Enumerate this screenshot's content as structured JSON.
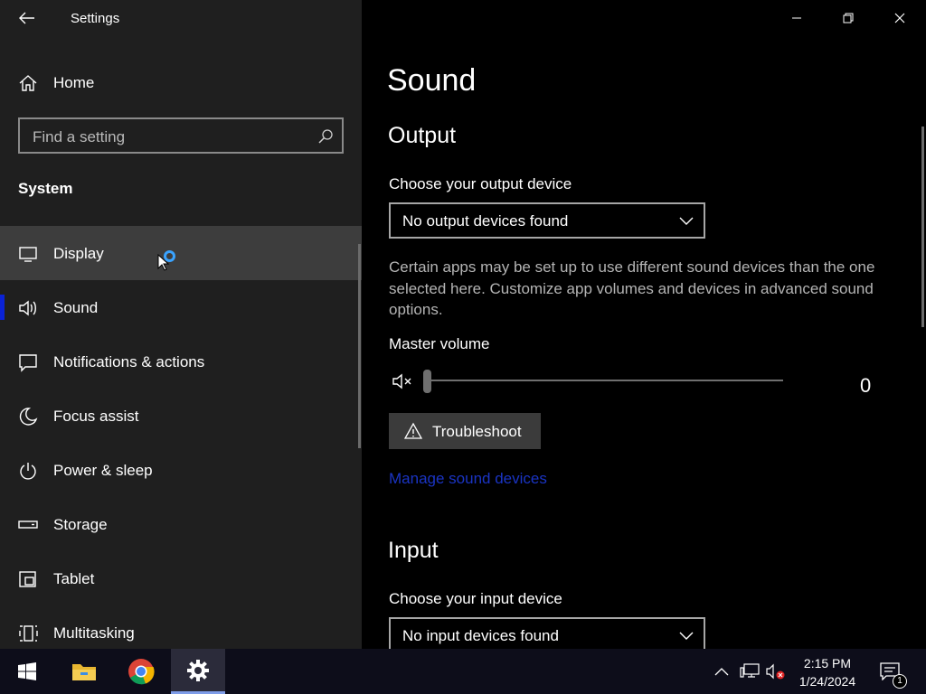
{
  "window": {
    "title": "Settings",
    "controls": {
      "minimize": "minimize-icon",
      "maximize": "restore-icon",
      "close": "close-icon"
    }
  },
  "sidebar": {
    "home_label": "Home",
    "search": {
      "placeholder": "Find a setting",
      "icon": "search-icon"
    },
    "section_label": "System",
    "items": [
      {
        "label": "Display",
        "icon": "monitor-icon",
        "state": "hover"
      },
      {
        "label": "Sound",
        "icon": "speaker-icon",
        "state": "selected"
      },
      {
        "label": "Notifications & actions",
        "icon": "message-icon",
        "state": ""
      },
      {
        "label": "Focus assist",
        "icon": "moon-icon",
        "state": ""
      },
      {
        "label": "Power & sleep",
        "icon": "power-icon",
        "state": ""
      },
      {
        "label": "Storage",
        "icon": "storage-icon",
        "state": ""
      },
      {
        "label": "Tablet",
        "icon": "tablet-icon",
        "state": ""
      },
      {
        "label": "Multitasking",
        "icon": "multitasking-icon",
        "state": ""
      }
    ]
  },
  "main": {
    "page_title": "Sound",
    "output": {
      "heading": "Output",
      "choose_label": "Choose your output device",
      "device_value": "No output devices found",
      "description": "Certain apps may be set up to use different sound devices than the one selected here. Customize app volumes and devices in advanced sound options.",
      "master_volume_label": "Master volume",
      "master_volume_value": "0",
      "master_volume_level": 0,
      "troubleshoot_label": "Troubleshoot",
      "manage_link": "Manage sound devices"
    },
    "input": {
      "heading": "Input",
      "choose_label": "Choose your input device",
      "device_value": "No input devices found"
    }
  },
  "taskbar": {
    "apps": [
      "start-icon",
      "file-explorer-icon",
      "chrome-icon",
      "settings-icon"
    ],
    "tray": [
      "chevron-up-icon",
      "network-icon",
      "volume-muted-icon"
    ],
    "time": "2:15 PM",
    "date": "1/24/2024",
    "notification_count": "1"
  },
  "colors": {
    "accent": "#0a22d6",
    "link": "#1a34c4",
    "busy": "#3aa3ff"
  }
}
